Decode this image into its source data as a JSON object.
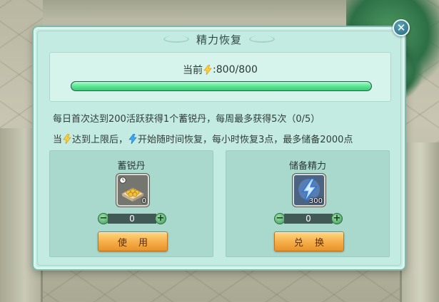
{
  "dialog": {
    "title": "精力恢复",
    "close_symbol": "✕"
  },
  "energy": {
    "label_prefix": "当前",
    "label_value": ":800/800",
    "current": 800,
    "max": 800,
    "fill_fraction": 1.0,
    "icon": "lightning-icon"
  },
  "info": {
    "line1": "每日首次达到200活跃获得1个蓄锐丹，每周最多获得5次（0/5）",
    "line2_part1": "当",
    "line2_part2": "达到上限后，",
    "line2_part3": "开始随时间恢复，每小时恢复3点，最多储备2000点"
  },
  "panels": {
    "left": {
      "title": "蓄锐丹",
      "item_count": "0",
      "stepper_value": "0",
      "button_label": "使 用",
      "icon": "pill-tray-icon"
    },
    "right": {
      "title": "储备精力",
      "item_count": "300",
      "stepper_value": "0",
      "button_label": "兑 换",
      "icon": "blue-lightning-crystal-icon"
    }
  },
  "stepper": {
    "minus": "−",
    "plus": "+"
  },
  "colors": {
    "dialog_bg": "#c3ebe1",
    "progress_fill": "#57e48f",
    "button_orange": "#f5ad47",
    "bolt_yellow": "#ffd23a",
    "bolt_blue": "#3aa8ff"
  }
}
